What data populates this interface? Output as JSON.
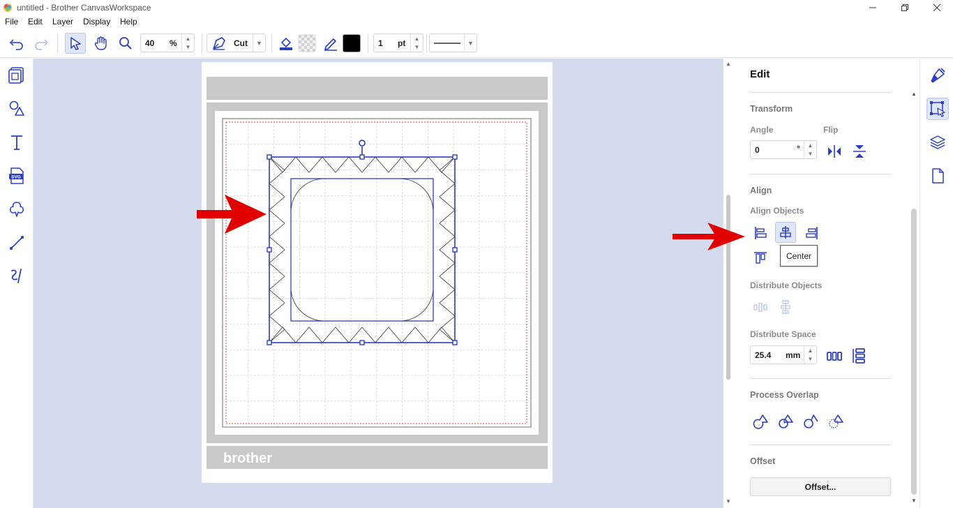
{
  "window": {
    "title": "untitled - Brother CanvasWorkspace",
    "minimize_icon": "minimize-icon",
    "restore_icon": "restore-icon",
    "close_icon": "close-icon"
  },
  "menu": [
    "File",
    "Edit",
    "Layer",
    "Display",
    "Help"
  ],
  "toolbar": {
    "zoom_value": "40",
    "zoom_unit": "%",
    "mode_label": "Cut",
    "line_width_value": "1",
    "line_width_unit": "pt",
    "line_color": "#000000",
    "icons": [
      "undo-icon",
      "redo-icon",
      "select-icon",
      "hand-icon",
      "zoom-icon",
      "pen-mode-icon",
      "fill-icon",
      "transparent-fill-icon",
      "line-color-icon",
      "line-style-dropdown"
    ]
  },
  "left_sidebar": [
    "pattern-icon",
    "shapes-icon",
    "text-icon",
    "svg-import-icon",
    "cloud-icon",
    "line-tool-icon",
    "freehand-icon"
  ],
  "mat": {
    "brand": "brother"
  },
  "edit_panel": {
    "heading": "Edit",
    "transform_title": "Transform",
    "angle_label": "Angle",
    "angle_value": "0",
    "angle_unit": "°",
    "flip_label": "Flip",
    "align_title": "Align",
    "align_objects_label": "Align Objects",
    "tooltip": "Center",
    "distribute_objects_label": "Distribute Objects",
    "distribute_space_label": "Distribute Space",
    "distribute_space_value": "25.4",
    "distribute_space_unit": "mm",
    "process_overlap_title": "Process Overlap",
    "offset_title": "Offset",
    "offset_button": "Offset..."
  },
  "right_sidebar": [
    "brush-icon",
    "edit-select-icon",
    "layers-icon",
    "page-icon"
  ],
  "colors": {
    "accent": "#2a3fbf",
    "selection": "#1f2fb8",
    "canvas_bg": "#d4dbef",
    "annotation_arrow": "#e00000"
  }
}
